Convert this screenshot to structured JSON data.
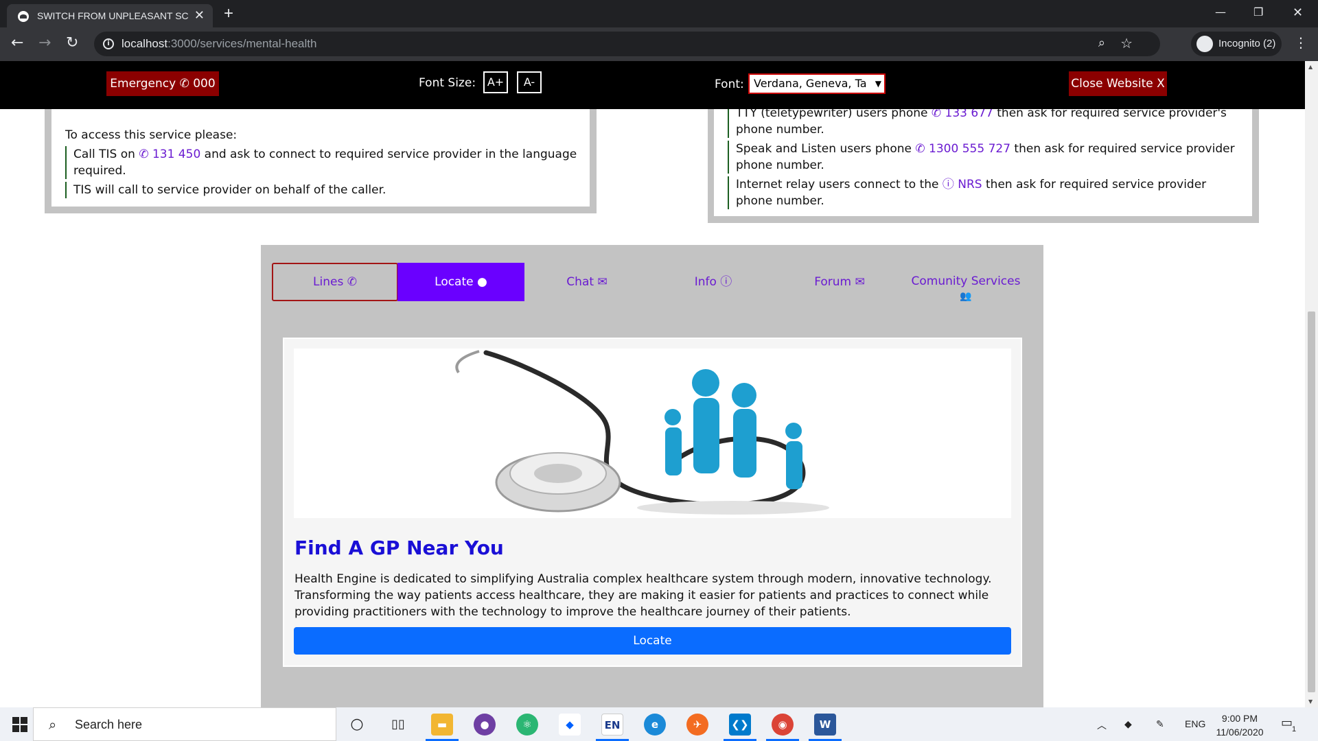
{
  "browser": {
    "tab_title": "SWITCH FROM UNPLEASANT SC",
    "url_host": "localhost",
    "url_path": ":3000/services/mental-health",
    "profile_label": "Incognito (2)"
  },
  "a11y_bar": {
    "emergency_label": "Emergency ✆ 000",
    "font_size_label": "Font Size:",
    "font_increase": "A+",
    "font_decrease": "A-",
    "font_label": "Font:",
    "font_value": "Verdana, Geneva, Ta",
    "close_label": "Close Website X"
  },
  "left_card": {
    "intro": "To access this service please:",
    "line1_pre": "Call TIS on ",
    "line1_phone": "✆ 131 450",
    "line1_post": " and ask to connect to required service provider in the language required.",
    "line2": "TIS will call to service provider on behalf of the caller."
  },
  "right_card": {
    "line1_pre": "TTY (teletypewriter) users phone ",
    "line1_phone": "✆ 133 677",
    "line1_post": " then ask for required service provider's phone number.",
    "line2_pre": "Speak and Listen users phone ",
    "line2_phone": "✆ 1300 555 727",
    "line2_post": " then ask for required service provider phone number.",
    "line3_pre": "Internet relay users connect to the ",
    "line3_link": "ⓘ NRS",
    "line3_post": " then ask for required service provider phone number."
  },
  "service_tabs": [
    {
      "label": "Lines ✆"
    },
    {
      "label": "Locate ●"
    },
    {
      "label": "Chat ✉"
    },
    {
      "label": "Info ⓘ"
    },
    {
      "label": "Forum ✉"
    },
    {
      "label": "Comunity Services",
      "icon": "👥"
    }
  ],
  "locate": {
    "title": "Find A GP Near You",
    "description": "Health Engine is dedicated to simplifying Australia complex healthcare system through modern, innovative technology. Transforming the way patients access healthcare, they are making it easier for patients and practices to connect while providing practitioners with the technology to improve the healthcare journey of their patients.",
    "button_label": "Locate"
  },
  "taskbar": {
    "search_placeholder": "Search here",
    "lang": "ENG",
    "time": "9:00 PM",
    "date": "11/06/2020",
    "en_label": "EN",
    "notification_count": "1"
  },
  "colors": {
    "accent_purple": "#6a00ff",
    "emergency_red": "#8b0000",
    "locate_blue": "#0a6cff",
    "title_blue": "#1a0fd6"
  }
}
